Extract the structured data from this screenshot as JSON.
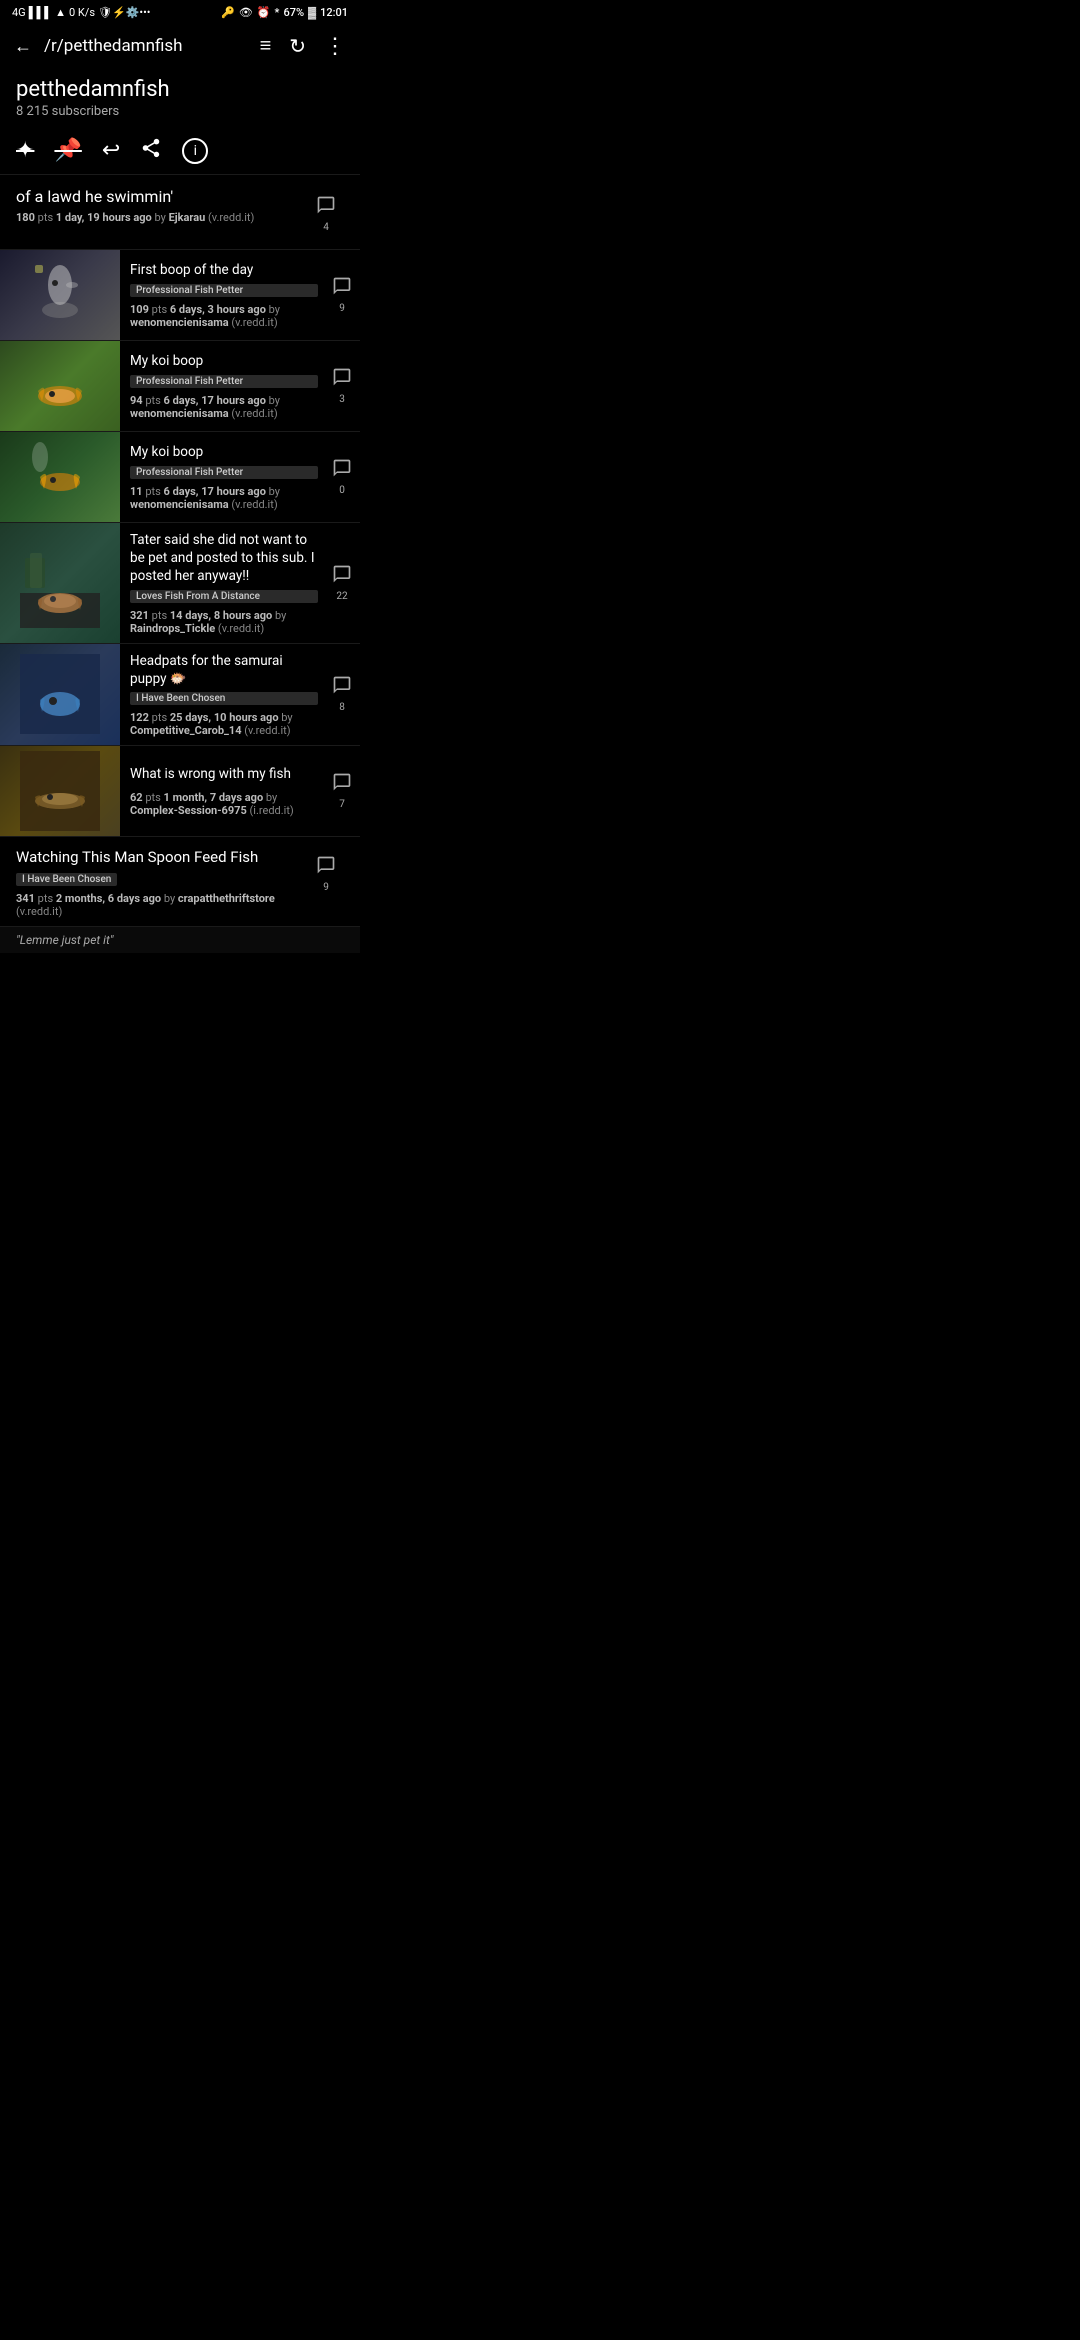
{
  "statusBar": {
    "signal": "4G",
    "wifi": "wifi",
    "dataSpeed": "0 K/s",
    "notifications": "0",
    "time": "12:01",
    "battery": "67%"
  },
  "appBar": {
    "backIcon": "←",
    "title": "/r/petthedamnfish",
    "filterIcon": "≡",
    "refreshIcon": "↻",
    "moreIcon": "⋮"
  },
  "subreddit": {
    "name": "petthedamnfish",
    "subscribers": "8 215 subscribers"
  },
  "actions": [
    {
      "name": "unstar",
      "icon": "✱",
      "label": "unstar"
    },
    {
      "name": "unpin",
      "icon": "📌",
      "label": "unpin"
    },
    {
      "name": "reply",
      "icon": "↩",
      "label": "reply"
    },
    {
      "name": "share",
      "icon": "⋗",
      "label": "share"
    },
    {
      "name": "info",
      "icon": "ⓘ",
      "label": "info"
    }
  ],
  "posts": [
    {
      "id": "post-0",
      "title": "of a lawd he swimmin'",
      "pts": "180",
      "time": "1 day, 19 hours ago",
      "by": "Ejkarau",
      "domain": "v.redd.it",
      "comments": "4",
      "flair": null,
      "hasThumbnail": false
    },
    {
      "id": "post-1",
      "title": "First boop of the day",
      "pts": "109",
      "time": "6 days, 3 hours ago",
      "by": "wenomencienisama",
      "domain": "v.redd.it",
      "comments": "9",
      "flair": "Professional Fish Petter",
      "hasThumbnail": true,
      "thumbClass": "thumb-1"
    },
    {
      "id": "post-2",
      "title": "My koi boop",
      "pts": "94",
      "time": "6 days, 17 hours ago",
      "by": "wenomencienisama",
      "domain": "v.redd.it",
      "comments": "3",
      "flair": "Professional Fish Petter",
      "hasThumbnail": true,
      "thumbClass": "thumb-2"
    },
    {
      "id": "post-3",
      "title": "My koi boop",
      "pts": "11",
      "time": "6 days, 17 hours ago",
      "by": "wenomencienisama",
      "domain": "v.redd.it",
      "comments": "0",
      "flair": "Professional Fish Petter",
      "hasThumbnail": true,
      "thumbClass": "thumb-3"
    },
    {
      "id": "post-4",
      "title": "Tater said she did not want to be pet and posted to this sub. I posted her anyway!!",
      "pts": "321",
      "time": "14 days, 8 hours ago",
      "by": "Raindrops_Tickle",
      "domain": "v.redd.it",
      "comments": "22",
      "flair": "Loves Fish From A Distance",
      "hasThumbnail": true,
      "thumbClass": "thumb-4"
    },
    {
      "id": "post-5",
      "title": "Headpats for the samurai puppy 🐡",
      "pts": "122",
      "time": "25 days, 10 hours ago",
      "by": "Competitive_Carob_14",
      "domain": "v.redd.it",
      "comments": "8",
      "flair": "I Have Been Chosen",
      "hasThumbnail": true,
      "thumbClass": "thumb-5"
    },
    {
      "id": "post-6",
      "title": "What is wrong with my fish",
      "pts": "62",
      "time": "1 month, 7 days ago",
      "by": "Complex-Session-6975",
      "domain": "i.redd.it",
      "comments": "7",
      "flair": null,
      "hasThumbnail": true,
      "thumbClass": "thumb-6"
    }
  ],
  "bottomPost": {
    "title": "Watching This Man Spoon Feed Fish",
    "flair": "I Have Been Chosen",
    "pts": "341",
    "time": "2 months, 6 days ago",
    "by": "crapatthethriftstore",
    "domain": "v.redd.it",
    "comments": "9"
  },
  "caption": "\"Lemme just pet it\""
}
